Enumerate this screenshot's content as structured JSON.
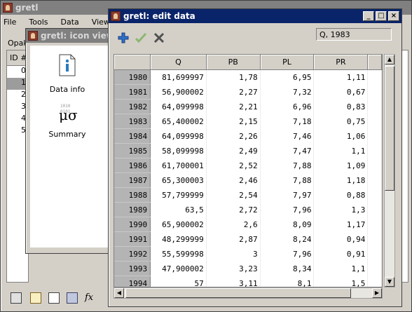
{
  "main_window": {
    "title": "gretl",
    "menu": [
      "File",
      "Tools",
      "Data",
      "View"
    ],
    "subhead": "Opak",
    "id_header": "ID #",
    "ids": [
      "0",
      "1",
      "2",
      "3",
      "4",
      "5"
    ]
  },
  "icon_view": {
    "title": "gretl: icon view",
    "icons": [
      {
        "label": "Data info",
        "icon": "info-document-icon"
      },
      {
        "label": "Summary",
        "icon": "summary-stats-icon"
      }
    ]
  },
  "edit_data": {
    "title": "gretl: edit data",
    "toolbar": {
      "add": "add-observation-icon",
      "apply": "apply-checkmark-icon",
      "close": "close-x-icon"
    },
    "obs_field": "Q, 1983",
    "columns": [
      "",
      "Q",
      "PB",
      "PL",
      "PR"
    ],
    "rows": [
      [
        "1980",
        "81,699997",
        "1,78",
        "6,95",
        "1,11"
      ],
      [
        "1981",
        "56,900002",
        "2,27",
        "7,32",
        "0,67"
      ],
      [
        "1982",
        "64,099998",
        "2,21",
        "6,96",
        "0,83"
      ],
      [
        "1983",
        "65,400002",
        "2,15",
        "7,18",
        "0,75"
      ],
      [
        "1984",
        "64,099998",
        "2,26",
        "7,46",
        "1,06"
      ],
      [
        "1985",
        "58,099998",
        "2,49",
        "7,47",
        "1,1"
      ],
      [
        "1986",
        "61,700001",
        "2,52",
        "7,88",
        "1,09"
      ],
      [
        "1987",
        "65,300003",
        "2,46",
        "7,88",
        "1,18"
      ],
      [
        "1988",
        "57,799999",
        "2,54",
        "7,97",
        "0,88"
      ],
      [
        "1989",
        "63,5",
        "2,72",
        "7,96",
        "1,3"
      ],
      [
        "1990",
        "65,900002",
        "2,6",
        "8,09",
        "1,17"
      ],
      [
        "1991",
        "48,299999",
        "2,87",
        "8,24",
        "0,94"
      ],
      [
        "1992",
        "55,599998",
        "3",
        "7,96",
        "0,91"
      ],
      [
        "1993",
        "47,900002",
        "3,23",
        "8,34",
        "1,1"
      ],
      [
        "1994",
        "57",
        "3,11",
        "8,1",
        "1,5"
      ]
    ]
  },
  "bottom_toolbar": {
    "fx_label": "fx"
  },
  "colors": {
    "active_title": "#0a246a",
    "inactive_title": "#808080",
    "row_header": "#b4b4b4"
  }
}
